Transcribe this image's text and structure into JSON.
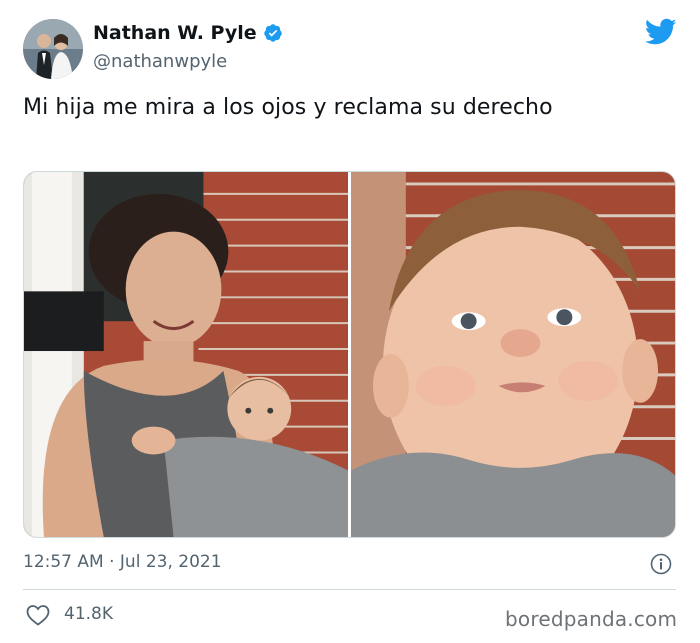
{
  "author": {
    "display_name": "Nathan W. Pyle",
    "handle": "@nathanwpyle",
    "verified": true
  },
  "tweet": {
    "text": "Mi hija me mira a los ojos y reclama su derecho",
    "timestamp": "12:57 AM · Jul 23, 2021",
    "like_count": "41.8K"
  },
  "icons": {
    "platform": "twitter-bird-icon",
    "verified": "verified-badge-icon",
    "info": "info-icon",
    "like": "heart-icon"
  },
  "colors": {
    "twitter_blue": "#1d9bf0",
    "secondary_text": "#536471",
    "primary_text": "#0f1419",
    "border": "#cfd9de"
  },
  "watermark": "boredpanda.com"
}
